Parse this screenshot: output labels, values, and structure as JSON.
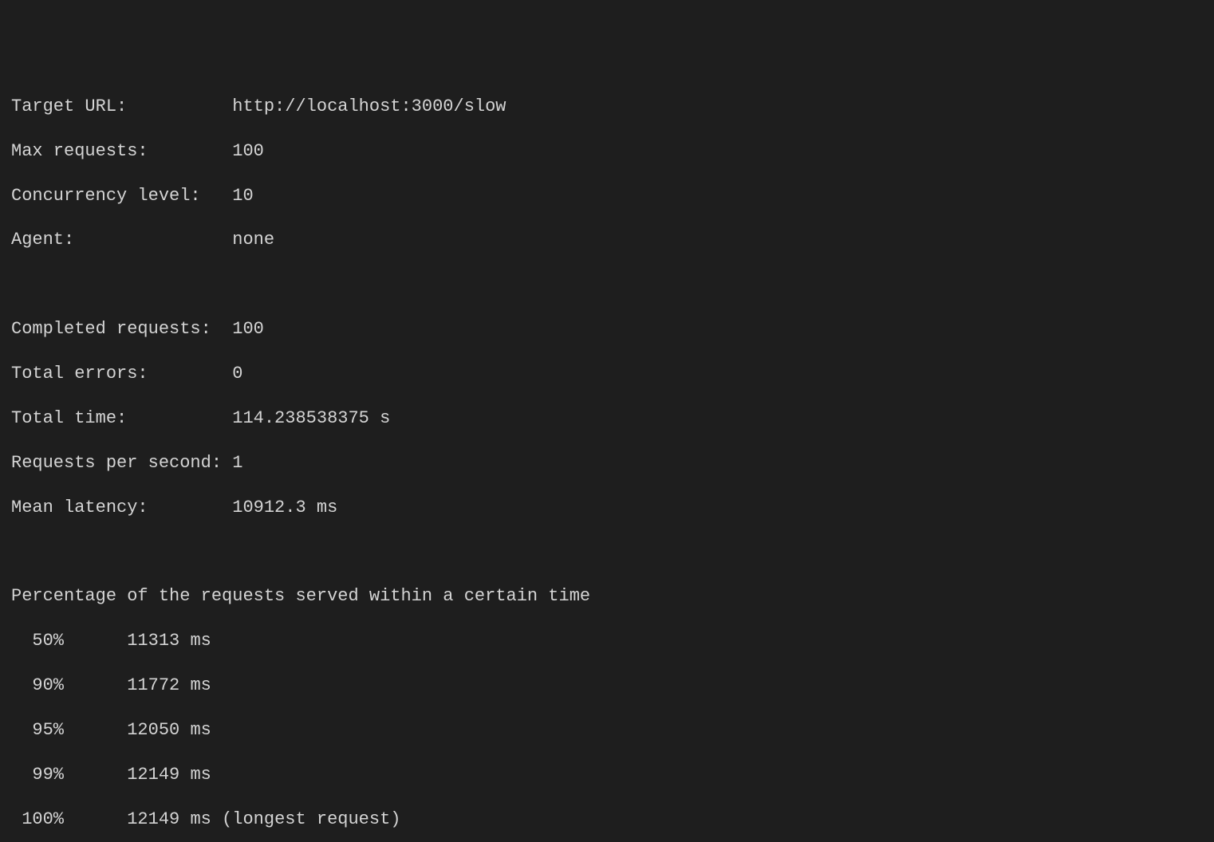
{
  "summary": {
    "target_url": {
      "label": "Target URL:          ",
      "value": "http://localhost:3000/slow"
    },
    "max_requests": {
      "label": "Max requests:        ",
      "value": "100"
    },
    "concurrency": {
      "label": "Concurrency level:   ",
      "value": "10"
    },
    "agent": {
      "label": "Agent:               ",
      "value": "none"
    },
    "completed": {
      "label": "Completed requests:  ",
      "value": "100"
    },
    "errors": {
      "label": "Total errors:        ",
      "value": "0"
    },
    "total_time": {
      "label": "Total time:          ",
      "value": "114.238538375 s"
    },
    "rps": {
      "label": "Requests per second: ",
      "value": "1"
    },
    "mean_latency": {
      "label": "Mean latency:        ",
      "value": "10912.3 ms"
    }
  },
  "percentiles": {
    "heading": "Percentage of the requests served within a certain time",
    "rows": [
      {
        "pct": "  50%      ",
        "time": "11313 ms"
      },
      {
        "pct": "  90%      ",
        "time": "11772 ms"
      },
      {
        "pct": "  95%      ",
        "time": "12050 ms"
      },
      {
        "pct": "  99%      ",
        "time": "12149 ms"
      },
      {
        "pct": " 100%      ",
        "time": "12149 ms (longest request)"
      }
    ]
  }
}
